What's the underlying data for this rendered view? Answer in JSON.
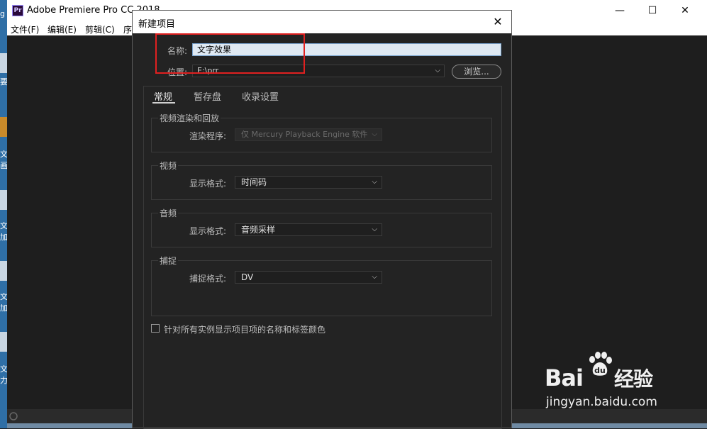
{
  "app": {
    "title": "Adobe Premiere Pro CC 2018",
    "logo_text": "Pr",
    "menu": [
      "文件(F)",
      "编辑(E)",
      "剪辑(C)",
      "序"
    ],
    "window_controls": {
      "minimize": "—",
      "maximize": "☐",
      "close": "✕"
    }
  },
  "desktop": {
    "labels": [
      "g",
      "要",
      "文",
      "画",
      "文",
      "加",
      "文",
      "加",
      "文",
      "力)"
    ]
  },
  "dialog": {
    "title": "新建项目",
    "close": "✕",
    "name_label": "名称:",
    "name_value": "文字效果",
    "location_label": "位置:",
    "location_value": "E:\\prr",
    "browse_label": "浏览...",
    "tabs": [
      {
        "label": "常规",
        "active": true
      },
      {
        "label": "暂存盘",
        "active": false
      },
      {
        "label": "收录设置",
        "active": false
      }
    ],
    "groups": {
      "playback": {
        "title": "视频渲染和回放",
        "field_label": "渲染程序:",
        "value": "仅 Mercury Playback Engine 软件",
        "disabled": true
      },
      "video": {
        "title": "视频",
        "field_label": "显示格式:",
        "value": "时间码"
      },
      "audio": {
        "title": "音频",
        "field_label": "显示格式:",
        "value": "音频采样"
      },
      "capture": {
        "title": "捕捉",
        "field_label": "捕捉格式:",
        "value": "DV"
      }
    },
    "checkbox_label": "针对所有实例显示项目项的名称和标签颜色",
    "checkbox_checked": false
  },
  "watermark": {
    "brand_left": "Bai",
    "brand_right": "经验",
    "site": "jingyan.baidu.com"
  },
  "colors": {
    "highlight": "#e02020",
    "accent_input_border": "#7aa4cf"
  }
}
